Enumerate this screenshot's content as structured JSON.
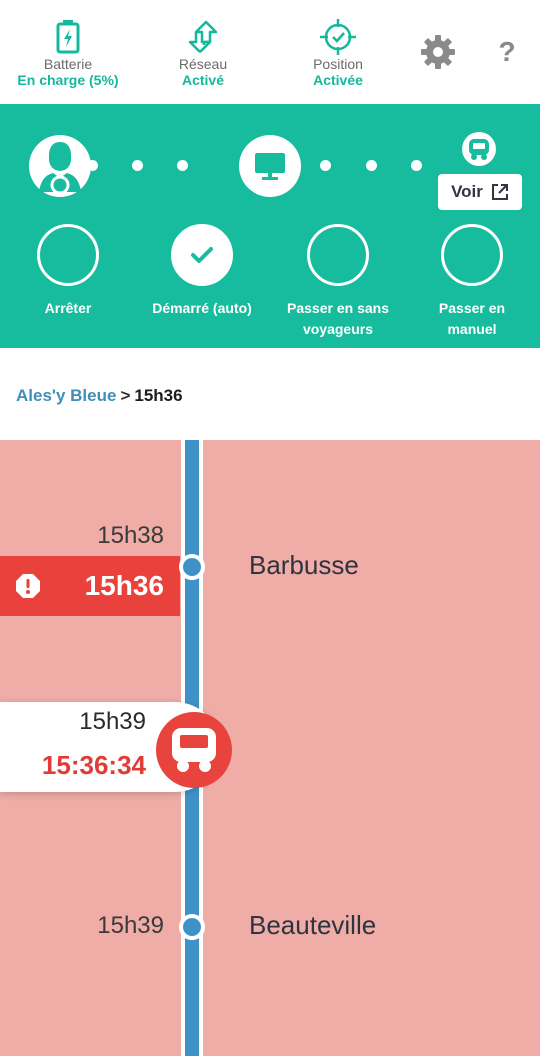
{
  "status": {
    "battery": {
      "label": "Batterie",
      "value": "En charge (5%)",
      "icon": "battery-charging-icon"
    },
    "network": {
      "label": "Réseau",
      "value": "Activé",
      "icon": "network-arrows-icon"
    },
    "position": {
      "label": "Position",
      "value": "Activée",
      "icon": "gps-target-icon"
    },
    "settings_icon": "gear-icon",
    "help_label": "?"
  },
  "panel": {
    "voir_label": "Voir",
    "actions": [
      {
        "label": "Arrêter",
        "active": false
      },
      {
        "label": "Démarré (auto)",
        "active": true
      },
      {
        "label": "Passer en sans voyageurs",
        "active": false
      },
      {
        "label": "Passer en manuel",
        "active": false
      }
    ]
  },
  "breadcrumb": {
    "line": "Ales'y Bleue",
    "separator": ">",
    "time": "15h36"
  },
  "timeline": {
    "stops": [
      {
        "scheduled": "15h38",
        "name": "Barbusse",
        "delay_time": "15h36"
      },
      {
        "scheduled": "15h39",
        "name": "Beauteville"
      }
    ],
    "bus": {
      "scheduled": "15h39",
      "live_time": "15:36:34"
    }
  },
  "colors": {
    "accent": "#17bc9f",
    "status_value": "#14b89c",
    "alert": "#e9423c",
    "timeline_bg": "#f0aca7",
    "track": "#3f92c8",
    "link": "#3f8fb8"
  }
}
